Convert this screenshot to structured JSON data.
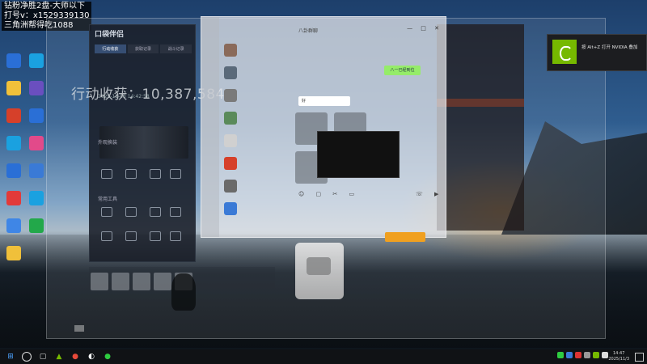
{
  "overlay": {
    "line1": "钻粉净胜2盘-大师以下",
    "line2": "打号v：x1529339130",
    "line3": "三角洲帮得吃1088"
  },
  "desktop_icons": [
    {
      "name": "desktop-icon-1",
      "color": "#2a6fd6"
    },
    {
      "name": "desktop-icon-2",
      "color": "#f0c03a"
    },
    {
      "name": "desktop-icon-3",
      "color": "#d6402a"
    },
    {
      "name": "desktop-icon-4",
      "color": "#1aa1e0"
    },
    {
      "name": "desktop-icon-5",
      "color": "#2a6fd6"
    },
    {
      "name": "desktop-icon-6",
      "color": "#e23a3a"
    },
    {
      "name": "desktop-icon-7",
      "color": "#3f86e6"
    },
    {
      "name": "desktop-icon-8",
      "color": "#f0c03a"
    },
    {
      "name": "desktop-icon-9",
      "color": "#1aa1e0"
    },
    {
      "name": "desktop-icon-10",
      "color": "#6a4fbf"
    },
    {
      "name": "desktop-icon-11",
      "color": "#2a6fd6"
    },
    {
      "name": "desktop-icon-12",
      "color": "#e24a8a"
    },
    {
      "name": "desktop-icon-13",
      "color": "#3a7ad6"
    },
    {
      "name": "desktop-icon-14",
      "color": "#1aa1e0"
    },
    {
      "name": "desktop-icon-15",
      "color": "#22a84a"
    }
  ],
  "assistant": {
    "title": "口袋伴侣",
    "tabs": [
      "行动收获",
      "获取记录",
      "战斗记录"
    ],
    "date": "2025-11-03 14:42:58",
    "section1": "外观换装",
    "section2": "常用工具"
  },
  "income": {
    "text": "行动收获：10,387,584"
  },
  "chat": {
    "title": "八卦群聊",
    "bubble": "八一已经到位",
    "reply": "好"
  },
  "toast": {
    "text": "按 Alt+Z 打开 NVIDIA 叠加"
  },
  "taskbar": {
    "time": "14:47",
    "date": "2025/11/3"
  },
  "colors": {
    "nvidia": "#76b900",
    "chat_bubble": "#95ec69",
    "buy_button": "#f0a020"
  }
}
